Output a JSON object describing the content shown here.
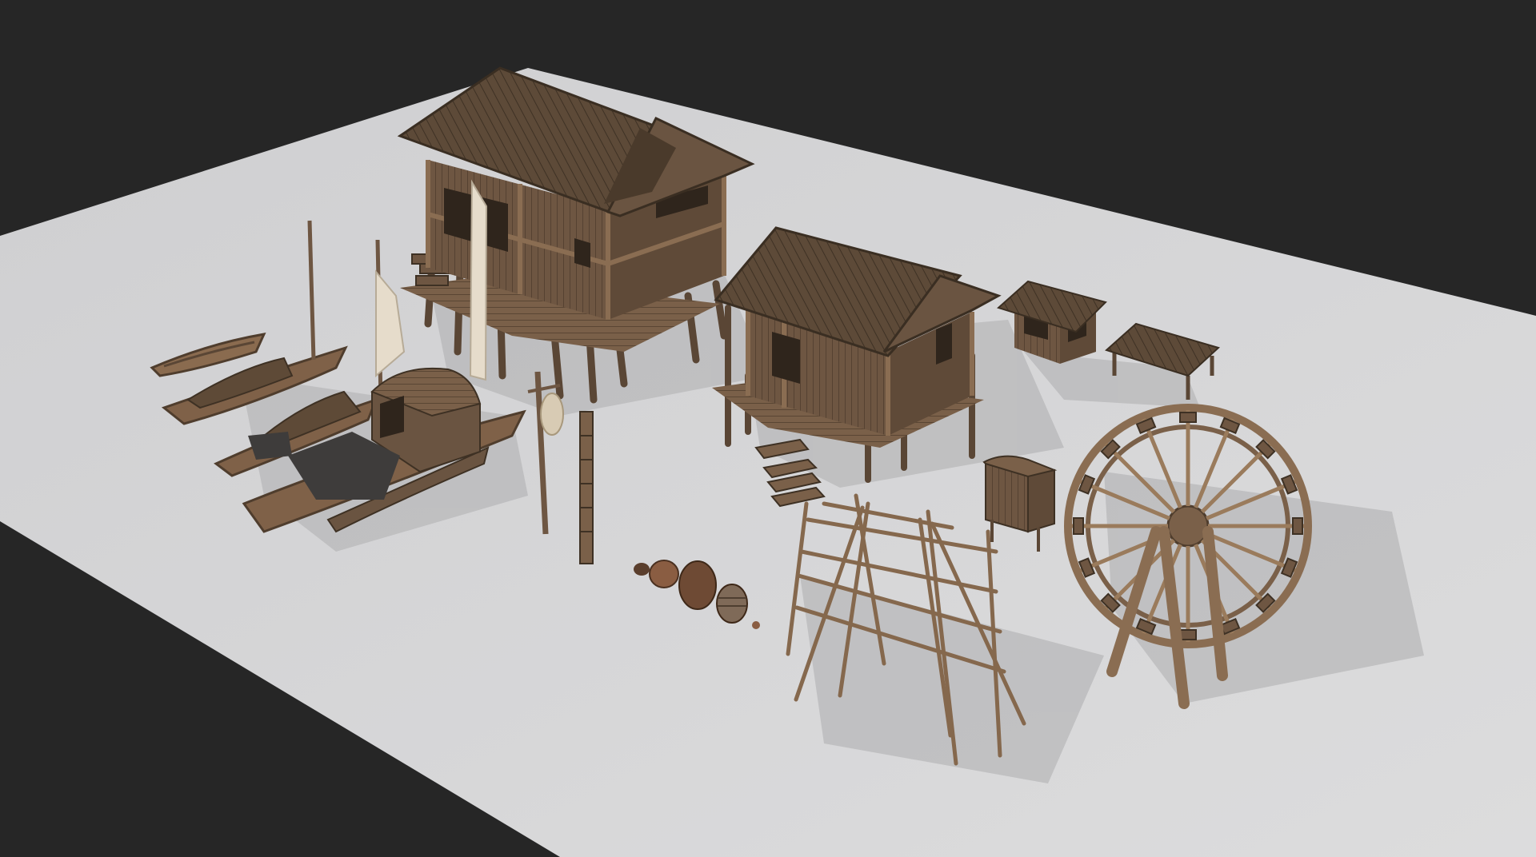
{
  "scene": {
    "background_color": "#262626",
    "ground_color": "#d6d6d7",
    "ground_shadow_color": "#b9b9bb",
    "wood_dark": "#4f3d2d",
    "wood_mid": "#735b45",
    "wood_light": "#9a7b5c",
    "roof_color": "#5d4a38",
    "sail_color": "#e6dccb",
    "cloth_color": "#3e3c3b",
    "pottery_color": "#6e4a34"
  },
  "objects": [
    {
      "name": "large-stilt-house"
    },
    {
      "name": "small-stilt-house"
    },
    {
      "name": "market-stall"
    },
    {
      "name": "wooden-table"
    },
    {
      "name": "water-wheel"
    },
    {
      "name": "drying-rack"
    },
    {
      "name": "boat-1"
    },
    {
      "name": "boat-2"
    },
    {
      "name": "boat-3"
    },
    {
      "name": "boat-4"
    },
    {
      "name": "lantern-pole"
    },
    {
      "name": "totem-post"
    },
    {
      "name": "pottery-set"
    },
    {
      "name": "wooden-cabinet"
    }
  ]
}
